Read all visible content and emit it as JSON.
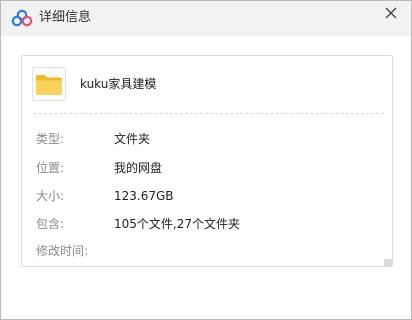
{
  "window": {
    "title": "详细信息",
    "app_icon": "cloud-icon",
    "close_icon": "close-icon"
  },
  "file": {
    "name": "kuku家具建模",
    "icon": "folder-icon",
    "icon_color": "#f5cc4b"
  },
  "details": [
    {
      "label": "类型:",
      "value": "文件夹"
    },
    {
      "label": "位置:",
      "value": "我的网盘"
    },
    {
      "label": "大小:",
      "value": "123.67GB"
    },
    {
      "label": "包含:",
      "value": "105个文件,27个文件夹"
    },
    {
      "label": "修改时间:",
      "value": ""
    }
  ],
  "colors": {
    "accent_blue": "#2a7be4",
    "accent_pink": "#e2507a",
    "titlebar_bg": "#f2f2f3"
  }
}
